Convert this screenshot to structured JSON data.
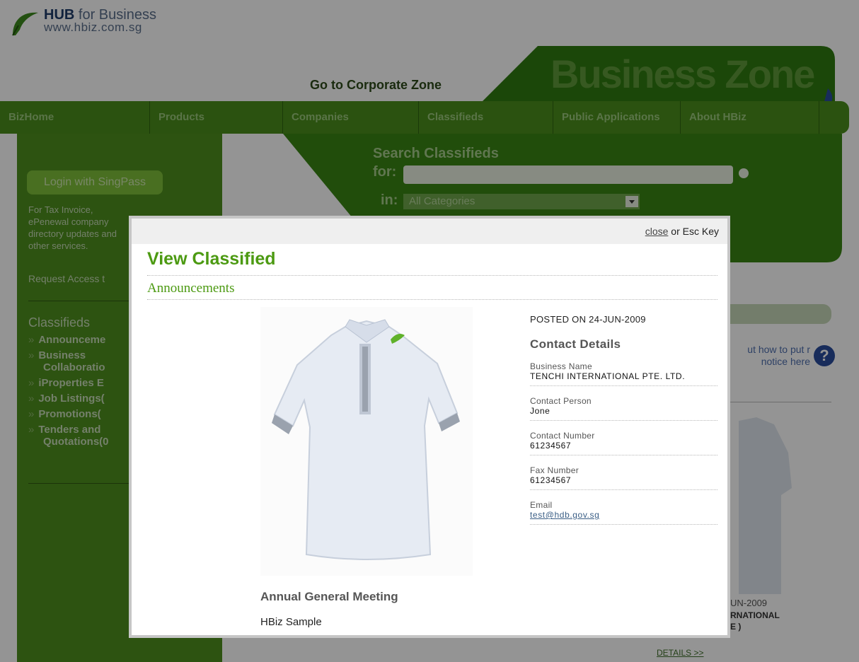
{
  "brand": {
    "name_bold": "HUB",
    "name_rest": " for Business",
    "url": "www.hbiz.com.sg"
  },
  "header": {
    "corporate_zone_link": "Go to Corporate Zone",
    "zone_title": "Business Zone"
  },
  "nav": {
    "items": [
      {
        "label": "BizHome"
      },
      {
        "label": "Products"
      },
      {
        "label": "Companies"
      },
      {
        "label": "Classifieds"
      },
      {
        "label": "Public Applications"
      },
      {
        "label": "About HBiz"
      }
    ]
  },
  "sidebar": {
    "login_label": "Login with SingPass",
    "tax_text": "For Tax Invoice, ePenewal company directory updates and other services.",
    "request_access": "Request Access t",
    "classifieds_heading": "Classifieds",
    "classifieds": [
      {
        "label": "Announceme",
        "sub": ""
      },
      {
        "label": "Business",
        "sub": "Collaboratio"
      },
      {
        "label": "iProperties E",
        "sub": ""
      },
      {
        "label": "Job Listings(",
        "sub": ""
      },
      {
        "label": "Promotions(",
        "sub": ""
      },
      {
        "label": "Tenders and",
        "sub": "Quotations(0"
      }
    ]
  },
  "search": {
    "title": "Search Classifieds",
    "for_label": "for:",
    "in_label": "in:",
    "query": "",
    "category_selected": "All Categories"
  },
  "right_panel": {
    "help_text": "ut how to put r notice here",
    "help_icon": "?",
    "date_fragment": "UN-2009",
    "company_fragment": "RNATIONAL",
    "company_fragment2": "E )",
    "details_link": "DETAILS >>"
  },
  "modal": {
    "close_label": "close",
    "close_hint": " or Esc Key",
    "title": "View Classified",
    "category": "Announcements",
    "posted": "POSTED ON 24-JUN-2009",
    "contact_heading": "Contact Details",
    "fields": [
      {
        "label": "Business Name",
        "value": "TENCHI INTERNATIONAL PTE. LTD."
      },
      {
        "label": "Contact Person",
        "value": "Jone"
      },
      {
        "label": "Contact Number",
        "value": "61234567"
      },
      {
        "label": "Fax Number",
        "value": "61234567"
      },
      {
        "label": "Email",
        "value": "test@hdb.gov.sg"
      }
    ],
    "item_title": "Annual General Meeting",
    "item_description": "HBiz Sample"
  },
  "colors": {
    "brand_green": "#4c9a12",
    "nav_green": "#4a8d1c",
    "link_blue": "#3a5e85"
  }
}
